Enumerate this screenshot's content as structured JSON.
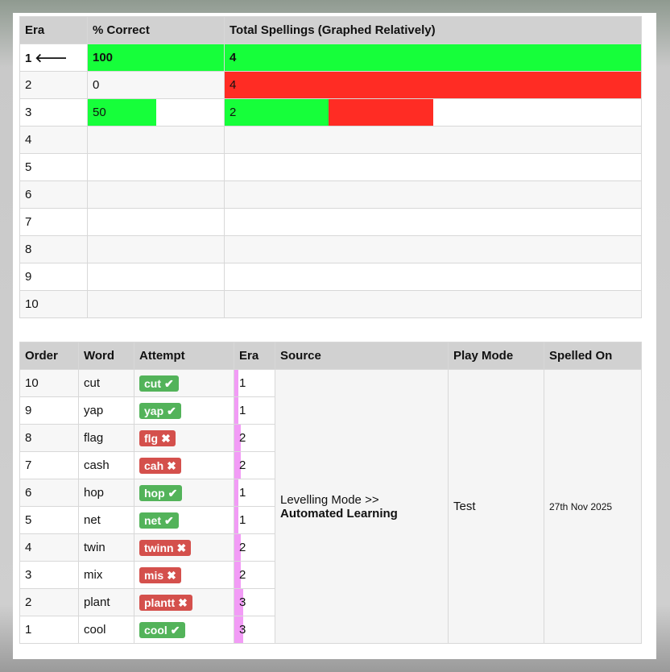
{
  "era_table": {
    "headers": [
      "Era",
      "% Correct",
      "Total Spellings (Graphed Relatively)"
    ],
    "rows": [
      {
        "era": "1",
        "current": true,
        "pct": "100",
        "pct_fill": 1.0,
        "total": "4",
        "correct": 4,
        "incorrect": 0
      },
      {
        "era": "2",
        "current": false,
        "pct": "0",
        "pct_fill": 0.0,
        "total": "4",
        "correct": 0,
        "incorrect": 4
      },
      {
        "era": "3",
        "current": false,
        "pct": "50",
        "pct_fill": 0.5,
        "total": "2",
        "correct": 1,
        "incorrect": 1
      },
      {
        "era": "4",
        "current": false,
        "pct": "",
        "pct_fill": 0,
        "total": "",
        "correct": 0,
        "incorrect": 0
      },
      {
        "era": "5",
        "current": false,
        "pct": "",
        "pct_fill": 0,
        "total": "",
        "correct": 0,
        "incorrect": 0
      },
      {
        "era": "6",
        "current": false,
        "pct": "",
        "pct_fill": 0,
        "total": "",
        "correct": 0,
        "incorrect": 0
      },
      {
        "era": "7",
        "current": false,
        "pct": "",
        "pct_fill": 0,
        "total": "",
        "correct": 0,
        "incorrect": 0
      },
      {
        "era": "8",
        "current": false,
        "pct": "",
        "pct_fill": 0,
        "total": "",
        "correct": 0,
        "incorrect": 0
      },
      {
        "era": "9",
        "current": false,
        "pct": "",
        "pct_fill": 0,
        "total": "",
        "correct": 0,
        "incorrect": 0
      },
      {
        "era": "10",
        "current": false,
        "pct": "",
        "pct_fill": 0,
        "total": "",
        "correct": 0,
        "incorrect": 0
      }
    ],
    "max_total": 4,
    "current_arrow": "🡐"
  },
  "word_table": {
    "headers": [
      "Order",
      "Word",
      "Attempt",
      "Era",
      "Source",
      "Play Mode",
      "Spelled On"
    ],
    "source_line1": "Levelling Mode >>",
    "source_line2": "Automated Learning",
    "play_mode": "Test",
    "spelled_on": "27th Nov 2025",
    "rows": [
      {
        "order": "10",
        "word": "cut",
        "attempt": "cut",
        "correct": true,
        "era": "1"
      },
      {
        "order": "9",
        "word": "yap",
        "attempt": "yap",
        "correct": true,
        "era": "1"
      },
      {
        "order": "8",
        "word": "flag",
        "attempt": "flg",
        "correct": false,
        "era": "2"
      },
      {
        "order": "7",
        "word": "cash",
        "attempt": "cah",
        "correct": false,
        "era": "2"
      },
      {
        "order": "6",
        "word": "hop",
        "attempt": "hop",
        "correct": true,
        "era": "1"
      },
      {
        "order": "5",
        "word": "net",
        "attempt": "net",
        "correct": true,
        "era": "1"
      },
      {
        "order": "4",
        "word": "twin",
        "attempt": "twinn",
        "correct": false,
        "era": "2"
      },
      {
        "order": "3",
        "word": "mix",
        "attempt": "mis",
        "correct": false,
        "era": "2"
      },
      {
        "order": "2",
        "word": "plant",
        "attempt": "plantt",
        "correct": false,
        "era": "3"
      },
      {
        "order": "1",
        "word": "cool",
        "attempt": "cool",
        "correct": true,
        "era": "3"
      }
    ]
  },
  "colors": {
    "correct": "#16ff3a",
    "incorrect": "#ff2c24",
    "badge_ok": "#53b35a",
    "badge_bad": "#d4504c",
    "era_bar": "#f29cf6"
  },
  "icons": {
    "check": "check-icon",
    "cross": "cross-icon",
    "arrow": "left-arrow-icon"
  }
}
